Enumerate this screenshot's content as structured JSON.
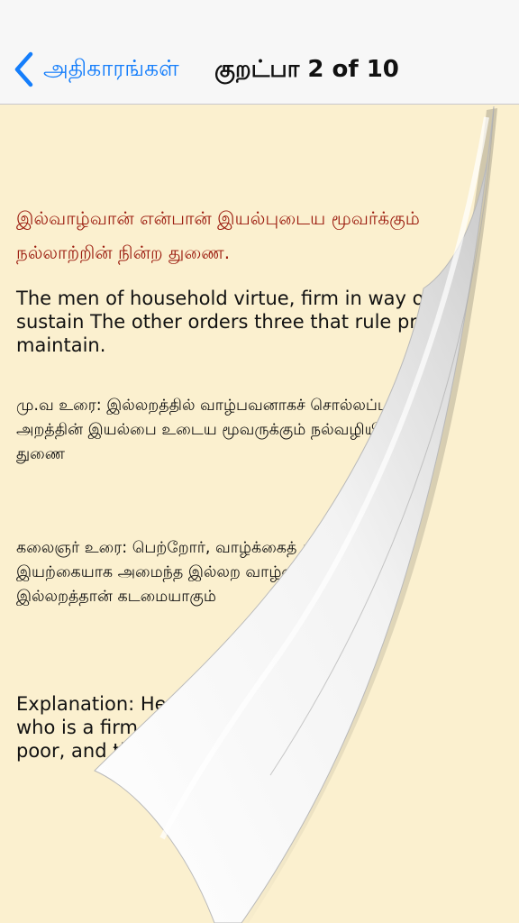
{
  "nav": {
    "back_label": "அதிகாரங்கள்",
    "title": "குறட்பா 2 of 10"
  },
  "kural": {
    "line1": "இல்வாழ்வான் என்பான் இயல்புடைய மூவர்க்கும்",
    "line2": "நல்லாற்றின் நின்ற துணை."
  },
  "english_translation": "The men of household virtue, firm in way of good, sustain The other orders three that rule professed maintain.",
  "mu_va_urai": "மு.வ உரை: இல்லறத்தில் வாழ்பவனாகச் சொல்லப்படுகிறவன் அறத்தின் இயல்பை உடைய மூவருக்கும் நல்வழியில் நிலை பெற்ற துணை",
  "kalaignar_urai": "கலைஞர் உரை: பெற்றோர், வாழ்க்கைத் துணை, குழந்தைகள் என இயற்கையாக அமைந்த இல்லற வாழ்வு துணையாக இருப்பது இல்லறத்தான் கடமையாகும்",
  "explanation": "Explanation: He who is said to flourish in domestic who is a firm support to the three orders in the poor, and the dead.",
  "colors": {
    "accent": "#157efb",
    "kural_text": "#9b1b0e",
    "page_background": "#fbf0cf"
  },
  "icons": {
    "back": "chevron-left-icon"
  }
}
